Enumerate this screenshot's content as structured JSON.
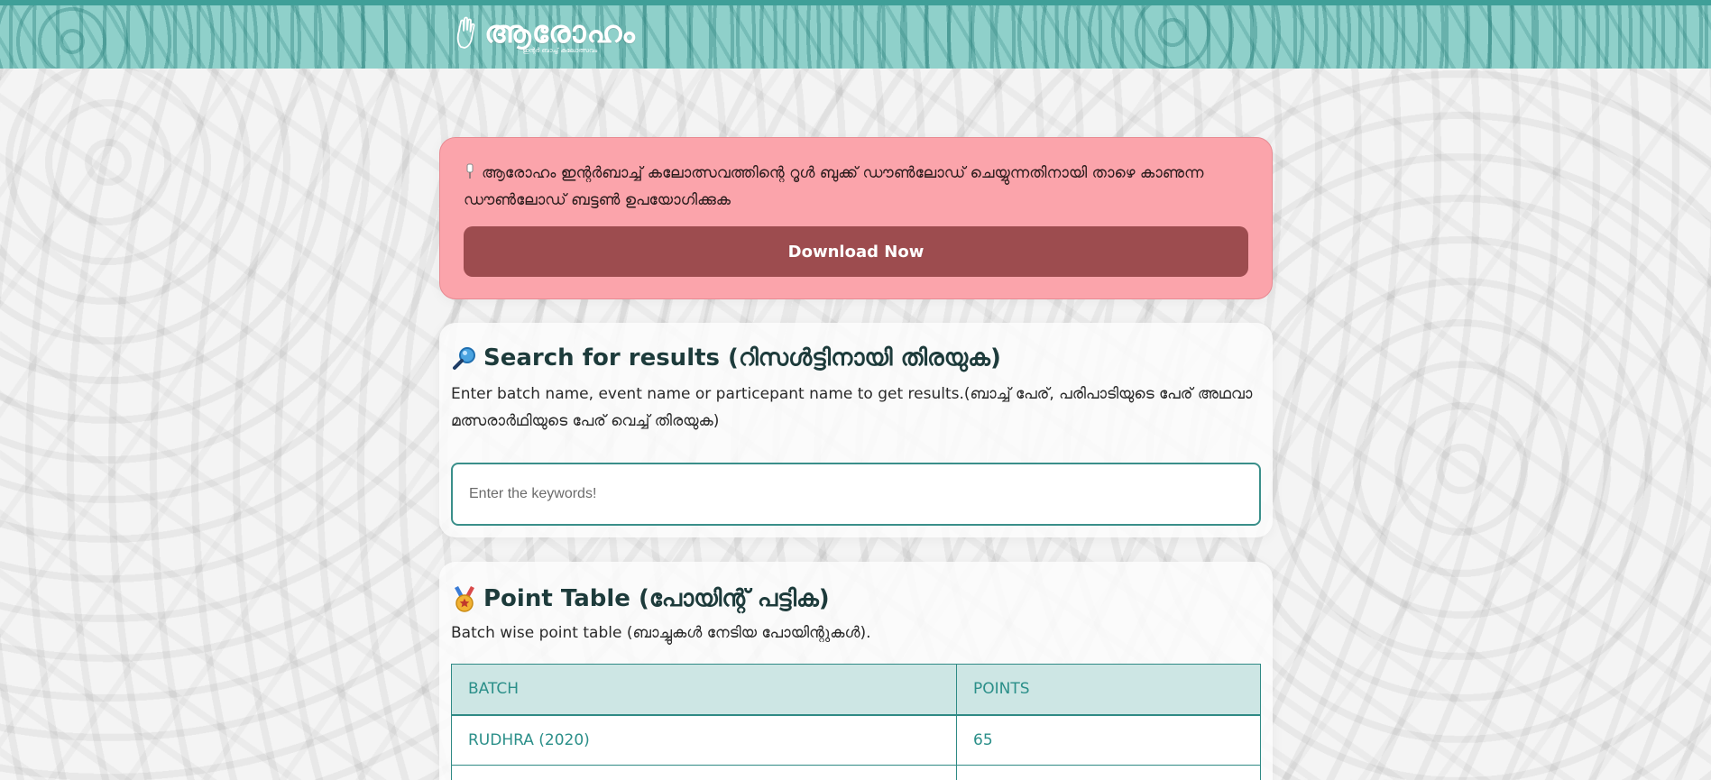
{
  "header": {
    "logo_title": "ആരോഹം",
    "logo_subtitle": "ഇന്റർ ബാച്ച് കലോത്സവം",
    "logo_icon": "hand-icon",
    "background_color": "#8fd0ca"
  },
  "alert": {
    "icon": "pin-icon",
    "message": "ആരോഹം ഇന്റർബാച്ച് കലോത്സവത്തിന്റെ റൂൾ ബുക്ക് ഡൗൺലോഡ് ചെയ്യുന്നതിനായി താഴെ കാണുന്ന ഡൗൺലോഡ് ബട്ടൺ ഉപയോഗിക്കുക",
    "button_label": "Download Now",
    "background_color": "#fba4ab",
    "button_color": "#9d4c4f"
  },
  "search": {
    "icon": "magnifier-icon",
    "title": "Search for results (റിസൾട്ടിനായി തിരയുക)",
    "description": "Enter batch name, event name or particepant name to get results.(ബാച്ച് പേര്, പരിപാടിയുടെ പേര് അഥവാ മത്സരാർഥിയുടെ പേര് വെച്ച് തിരയുക)",
    "placeholder": "Enter the keywords!",
    "value": ""
  },
  "points": {
    "icon": "medal-icon",
    "title": "Point Table (പോയിന്റ് പട്ടിക)",
    "description": "Batch wise point table (ബാച്ചുകൾ നേടിയ പോയിന്റുകൾ).",
    "columns": [
      "BATCH",
      "POINTS"
    ],
    "rows": [
      {
        "batch": "RUDHRA (2020)",
        "points": "65"
      },
      {
        "batch": "",
        "points": ""
      }
    ],
    "accent_color": "#2f8a85"
  }
}
